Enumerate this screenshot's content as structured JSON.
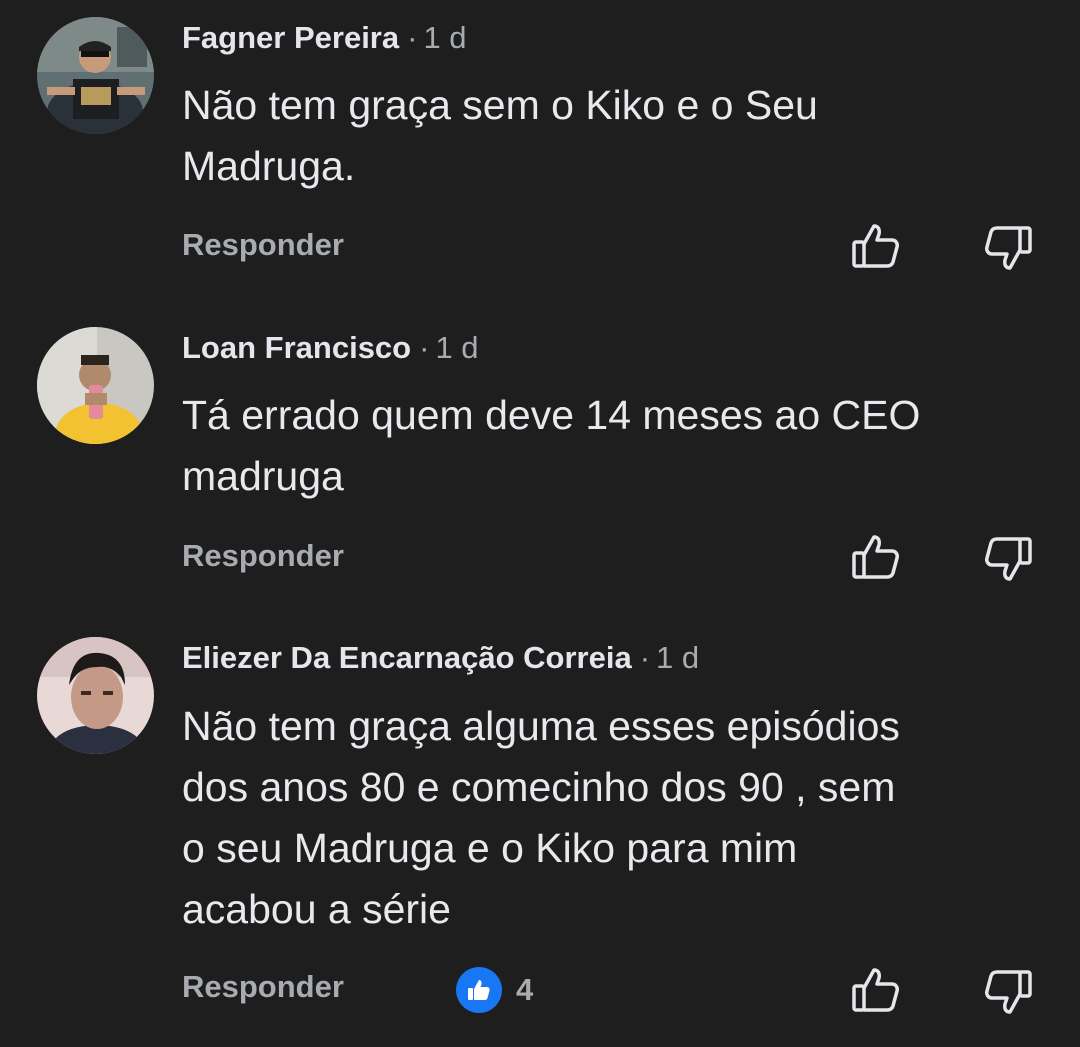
{
  "comments": [
    {
      "author": "Fagner Pereira",
      "separator": "·",
      "time": "1 d",
      "text_lines": [
        "Não tem graça sem o Kiko e o Seu",
        "Madruga."
      ],
      "reply_label": "Responder"
    },
    {
      "author": "Loan Francisco",
      "separator": "·",
      "time": "1 d",
      "text_lines": [
        "Tá errado quem deve 14 meses ao CEO",
        "madruga"
      ],
      "reply_label": "Responder"
    },
    {
      "author": "Eliezer Da Encarnação Correia",
      "separator": "·",
      "time": "1 d",
      "text_lines": [
        "Não tem graça alguma esses episódios",
        "dos anos 80 e comecinho dos 90 , sem",
        "o seu Madruga e o Kiko para mim",
        "acabou a série"
      ],
      "reply_label": "Responder",
      "reaction_count": "4"
    }
  ],
  "icons": {
    "like": "thumbs-up-outline-icon",
    "dislike": "thumbs-down-outline-icon",
    "reaction": "like-reaction-icon"
  },
  "colors": {
    "background": "#1e1e1f",
    "text": "#e8e9ec",
    "secondary_text": "#a8abb0",
    "reaction_blue": "#1877f2"
  }
}
